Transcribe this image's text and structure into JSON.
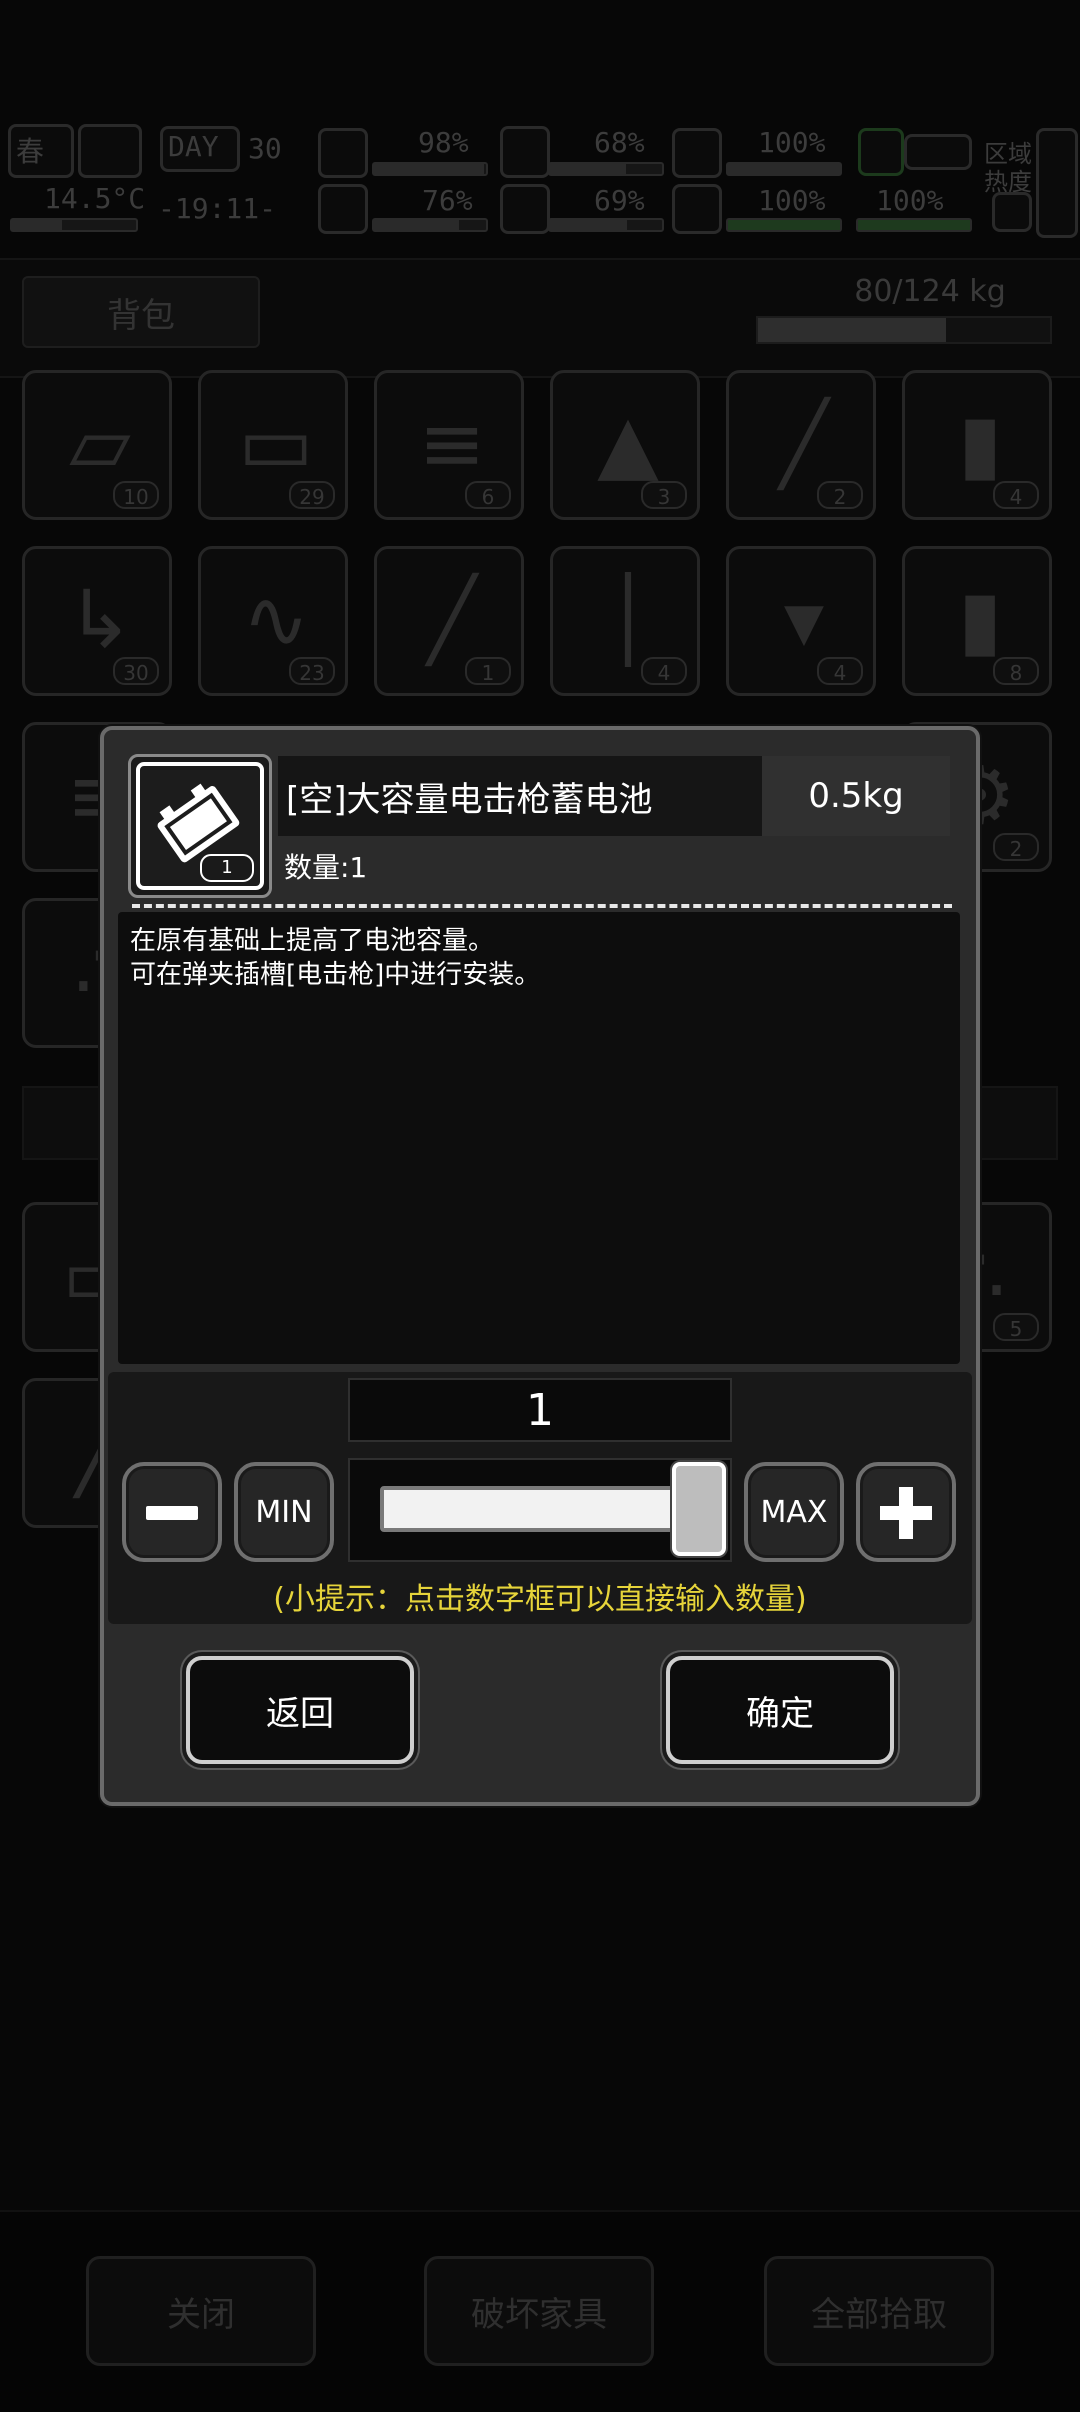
{
  "hud": {
    "season": "春",
    "day_label": "DAY",
    "day_value": "30",
    "temperature": "14.5°C",
    "time": "-19:11-",
    "stats": [
      {
        "name": "health",
        "value": "98%"
      },
      {
        "name": "hunger",
        "value": "68%"
      },
      {
        "name": "armor",
        "value": "100%"
      },
      {
        "name": "mental",
        "value": "76%"
      },
      {
        "name": "thirst",
        "value": "69%"
      },
      {
        "name": "heart",
        "value": "100%"
      },
      {
        "name": "stamina",
        "value": "100%"
      }
    ],
    "zone_heat_line1": "区域",
    "zone_heat_line2": "热度"
  },
  "bag": {
    "tab_label": "背包",
    "weight": "80/124 kg",
    "weight_fraction": 0.645,
    "slots_row1": [
      {
        "icon": "planks-icon",
        "count": "10"
      },
      {
        "icon": "brick-icon",
        "count": "29"
      },
      {
        "icon": "stone-slab-icon",
        "count": "6"
      },
      {
        "icon": "soil-sprout-icon",
        "count": "3"
      },
      {
        "icon": "nails-icon",
        "count": "2"
      },
      {
        "icon": "bottle-icon",
        "count": "4"
      }
    ],
    "slots_row2": [
      {
        "icon": "pipe-scrap-icon",
        "count": "30"
      },
      {
        "icon": "spring-icon",
        "count": "23"
      },
      {
        "icon": "syringe-icon",
        "count": "1"
      },
      {
        "icon": "knife-icon",
        "count": "4"
      },
      {
        "icon": "bucket-icon",
        "count": "4"
      },
      {
        "icon": "spray-bottle-icon",
        "count": "8"
      }
    ],
    "gear_count": "2",
    "bottom_right_count": "5"
  },
  "dialog": {
    "item_name": "[空]大容量电击枪蓄电池",
    "item_weight": "0.5kg",
    "item_icon": "battery-icon",
    "icon_count": "1",
    "quantity_label": "数量:1",
    "description_lines": [
      "在原有基础上提高了电池容量。",
      "可在弹夹插槽[电击枪]中进行安装。"
    ],
    "number_value": "1",
    "slider_fraction": 1.0,
    "min_label": "MIN",
    "max_label": "MAX",
    "hint": "(小提示：点击数字框可以直接输入数量)",
    "back_label": "返回",
    "confirm_label": "确定"
  },
  "bottom": {
    "close_label": "关闭",
    "destroy_label": "破坏家具",
    "pickup_all_label": "全部拾取"
  }
}
